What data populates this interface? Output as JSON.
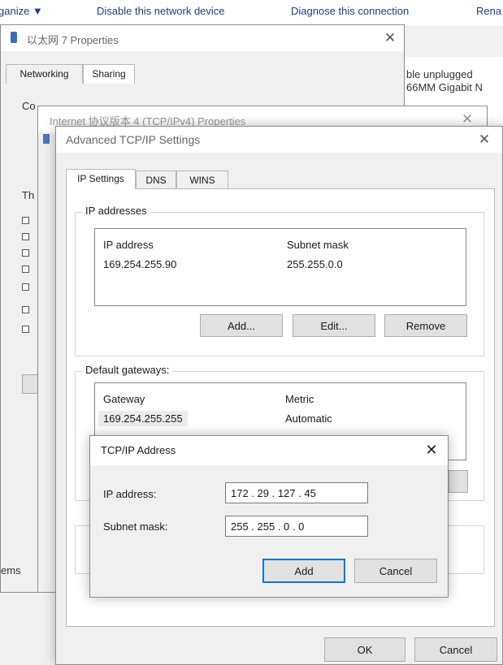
{
  "explorer": {
    "cmd_organize": "ganize ▼",
    "cmd_disable": "Disable this network device",
    "cmd_diagnose": "Diagnose this connection",
    "cmd_rename": "Rena",
    "status_line1": "ble unplugged",
    "status_line2": "66MM Gigabit N",
    "left_fragment": "ems"
  },
  "ethernet_props": {
    "title": "以太网 7 Properties",
    "tab_networking": "Networking",
    "tab_sharing": "Sharing",
    "connect_using_fragment": "Co",
    "this_connection_fragment": "Th"
  },
  "ipv4_props": {
    "title_fragment": "Internet 协议版本 4 (TCP/IPv4) Properties"
  },
  "advanced": {
    "title": "Advanced TCP/IP Settings",
    "tabs": [
      "IP Settings",
      "DNS",
      "WINS"
    ],
    "ip_addresses_legend": "IP addresses",
    "ip_table_headers": [
      "IP address",
      "Subnet mask"
    ],
    "ip_rows": [
      [
        "169.254.255.90",
        "255.255.0.0"
      ]
    ],
    "add_label": "Add...",
    "edit_label": "Edit...",
    "remove_label": "Remove",
    "gateways_legend": "Default gateways:",
    "gw_table_headers": [
      "Gateway",
      "Metric"
    ],
    "gw_rows": [
      [
        "169.254.255.255",
        "Automatic"
      ]
    ],
    "ok_label": "OK",
    "cancel_label": "Cancel"
  },
  "tcpip_dialog": {
    "title": "TCP/IP Address",
    "ip_label": "IP address:",
    "ip_value": "172 . 29 . 127 . 45",
    "mask_label": "Subnet mask:",
    "mask_value": "255 . 255 . 0 . 0",
    "add_label": "Add",
    "cancel_label": "Cancel"
  }
}
